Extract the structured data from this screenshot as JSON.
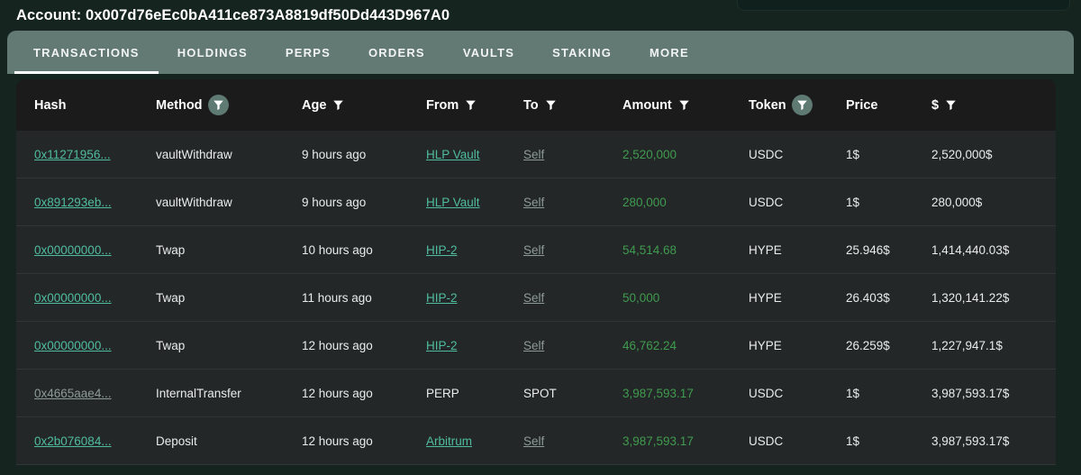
{
  "header": {
    "account_label": "Account: 0x007d76eEc0bA411ce873A8819df50Dd443D967A0"
  },
  "tabs": [
    {
      "label": "TRANSACTIONS",
      "active": true
    },
    {
      "label": "HOLDINGS",
      "active": false
    },
    {
      "label": "PERPS",
      "active": false
    },
    {
      "label": "ORDERS",
      "active": false
    },
    {
      "label": "VAULTS",
      "active": false
    },
    {
      "label": "STAKING",
      "active": false
    },
    {
      "label": "MORE",
      "active": false
    }
  ],
  "table": {
    "columns": [
      {
        "key": "hash",
        "label": "Hash",
        "filter": "none"
      },
      {
        "key": "method",
        "label": "Method",
        "filter": "active"
      },
      {
        "key": "age",
        "label": "Age",
        "filter": "plain"
      },
      {
        "key": "from",
        "label": "From",
        "filter": "plain"
      },
      {
        "key": "to",
        "label": "To",
        "filter": "plain"
      },
      {
        "key": "amount",
        "label": "Amount",
        "filter": "plain"
      },
      {
        "key": "token",
        "label": "Token",
        "filter": "active"
      },
      {
        "key": "price",
        "label": "Price",
        "filter": "none"
      },
      {
        "key": "usd",
        "label": "$",
        "filter": "plain"
      }
    ],
    "rows": [
      {
        "hash": "0x11271956...",
        "hash_style": "link",
        "method": "vaultWithdraw",
        "age": "9 hours ago",
        "from": "HLP Vault",
        "from_style": "link",
        "to": "Self",
        "to_style": "link-dim",
        "amount": "2,520,000",
        "token": "USDC",
        "price": "1$",
        "usd": "2,520,000$"
      },
      {
        "hash": "0x891293eb...",
        "hash_style": "link",
        "method": "vaultWithdraw",
        "age": "9 hours ago",
        "from": "HLP Vault",
        "from_style": "link",
        "to": "Self",
        "to_style": "link-dim",
        "amount": "280,000",
        "token": "USDC",
        "price": "1$",
        "usd": "280,000$"
      },
      {
        "hash": "0x00000000...",
        "hash_style": "link",
        "method": "Twap",
        "age": "10 hours ago",
        "from": "HIP-2",
        "from_style": "link",
        "to": "Self",
        "to_style": "link-dim",
        "amount": "54,514.68",
        "token": "HYPE",
        "price": "25.946$",
        "usd": "1,414,440.03$"
      },
      {
        "hash": "0x00000000...",
        "hash_style": "link",
        "method": "Twap",
        "age": "11 hours ago",
        "from": "HIP-2",
        "from_style": "link",
        "to": "Self",
        "to_style": "link-dim",
        "amount": "50,000",
        "token": "HYPE",
        "price": "26.403$",
        "usd": "1,320,141.22$"
      },
      {
        "hash": "0x00000000...",
        "hash_style": "link",
        "method": "Twap",
        "age": "12 hours ago",
        "from": "HIP-2",
        "from_style": "link",
        "to": "Self",
        "to_style": "link-dim",
        "amount": "46,762.24",
        "token": "HYPE",
        "price": "26.259$",
        "usd": "1,227,947.1$"
      },
      {
        "hash": "0x4665aae4...",
        "hash_style": "link-dim",
        "method": "InternalTransfer",
        "age": "12 hours ago",
        "from": "PERP",
        "from_style": "plain",
        "to": "SPOT",
        "to_style": "plain",
        "amount": "3,987,593.17",
        "token": "USDC",
        "price": "1$",
        "usd": "3,987,593.17$"
      },
      {
        "hash": "0x2b076084...",
        "hash_style": "link",
        "method": "Deposit",
        "age": "12 hours ago",
        "from": "Arbitrum",
        "from_style": "link",
        "to": "Self",
        "to_style": "link-dim",
        "amount": "3,987,593.17",
        "token": "USDC",
        "price": "1$",
        "usd": "3,987,593.17$"
      }
    ]
  },
  "colors": {
    "page_bg": "#15241f",
    "tabbar_bg": "#637a74",
    "header_row_bg": "#1b1b1b",
    "body_row_bg": "#242727",
    "link": "#4fbd9c",
    "link_dim": "#8d9a97",
    "amount_green": "#3f9b4f",
    "filter_active_bg": "#5f7a73"
  }
}
